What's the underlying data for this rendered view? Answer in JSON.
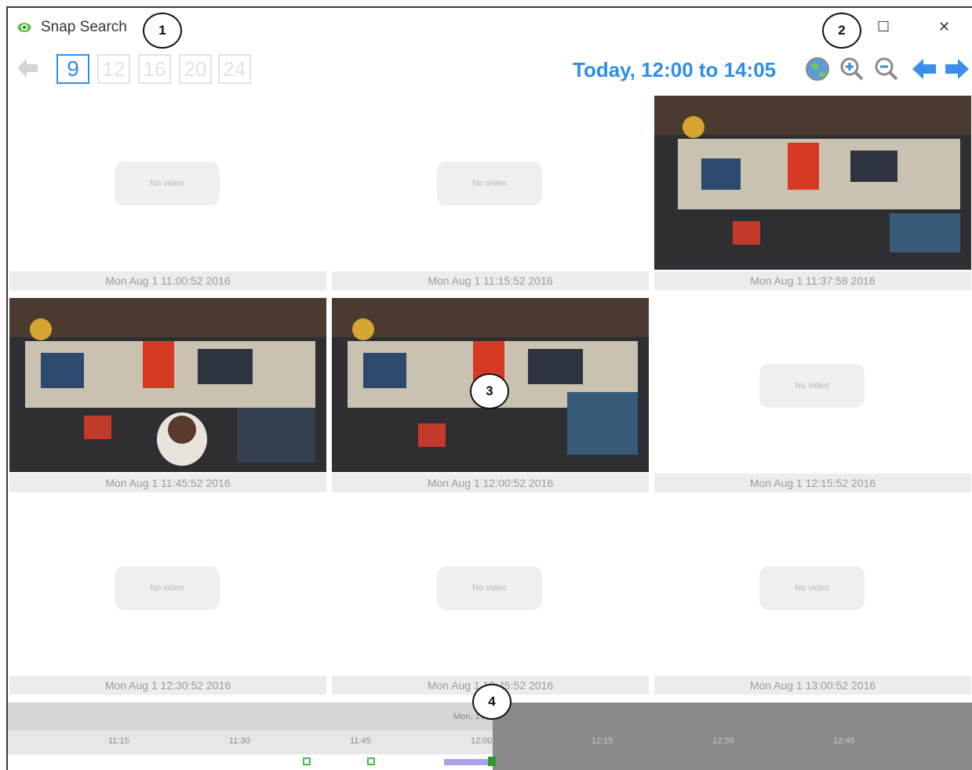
{
  "window": {
    "title": "Snap Search",
    "maximize_glyph": "☐",
    "close_glyph": "✕",
    "app_icon": "eye-icon"
  },
  "callouts": [
    "1",
    "2",
    "3",
    "4"
  ],
  "toolbar": {
    "grid_sizes": [
      "9",
      "12",
      "16",
      "20",
      "24"
    ],
    "selected_grid_size": "9",
    "range_label": "Today, 12:00 to 14:05",
    "icons": [
      "back-disabled-icon",
      "globe-icon",
      "zoom-in-icon",
      "zoom-out-icon",
      "arrow-left-icon",
      "arrow-right-icon"
    ]
  },
  "snapshots": [
    {
      "timestamp": "Mon Aug 1 11:00:52 2016",
      "has_video": false,
      "placeholder": "No video"
    },
    {
      "timestamp": "Mon Aug 1 11:15:52 2016",
      "has_video": false,
      "placeholder": "No video"
    },
    {
      "timestamp": "Mon Aug 1 11:37:58 2016",
      "has_video": true,
      "placeholder": ""
    },
    {
      "timestamp": "Mon Aug 1 11:45:52 2016",
      "has_video": true,
      "placeholder": ""
    },
    {
      "timestamp": "Mon Aug 1 12:00:52 2016",
      "has_video": true,
      "placeholder": ""
    },
    {
      "timestamp": "Mon Aug 1 12:15:52 2016",
      "has_video": false,
      "placeholder": "No video"
    },
    {
      "timestamp": "Mon Aug 1 12:30:52 2016",
      "has_video": false,
      "placeholder": "No video"
    },
    {
      "timestamp": "Mon Aug 1 12:45:52 2016",
      "has_video": false,
      "placeholder": "No video"
    },
    {
      "timestamp": "Mon Aug 1 13:00:52 2016",
      "has_video": false,
      "placeholder": "No video"
    }
  ],
  "timeline": {
    "date_label": "Mon, 1 Aug",
    "ticks": [
      "11:15",
      "11:30",
      "11:45",
      "12:00",
      "12:15",
      "12:30",
      "12:45"
    ]
  },
  "colors": {
    "accent": "#2d8ee8",
    "marker_green": "#3fbf3f",
    "range_purple": "#a8a2e8",
    "future_gray": "#8a8a8a"
  }
}
